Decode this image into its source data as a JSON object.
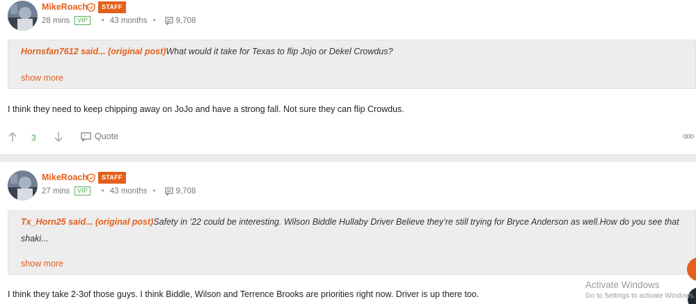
{
  "posts": [
    {
      "author": "MikeRoach",
      "badge": "STAFF",
      "time": "28 mins",
      "vip": "VIP",
      "tenure": "43 months",
      "post_count": "9,708",
      "quote_author": "Hornsfan7612 said...",
      "quote_link": "(original post)",
      "quote_text": "What would it take for Texas to flip Jojo or Dekel Crowdus?",
      "show_more": "show more",
      "body": "I think they need to keep chipping away on JoJo and have a strong fall. Not sure they can flip Crowdus.",
      "score": "3",
      "quote_label": "Quote",
      "more": "ooo"
    },
    {
      "author": "MikeRoach",
      "badge": "STAFF",
      "time": "27 mins",
      "vip": "VIP",
      "tenure": "43 months",
      "post_count": "9,708",
      "quote_author": "Tx_Horn25 said...",
      "quote_link": "(original post)",
      "quote_text": "Safety in ‘22 could be interesting. Wilson Biddle Hullaby Driver Believe they’re still trying for Bryce Anderson as well.How do you see that shaki...",
      "show_more": "show more",
      "body": "I think they take 2-3of those guys. I think Biddle, Wilson and Terrence Brooks are priorities right now. Driver is up there too."
    }
  ],
  "watermark": {
    "title": "Activate Windows",
    "subtitle": "Go to Settings to activate Windows."
  },
  "colors": {
    "accent": "#e35f1b",
    "vip_green": "#4aa84a",
    "quote_bg": "#ededed"
  }
}
